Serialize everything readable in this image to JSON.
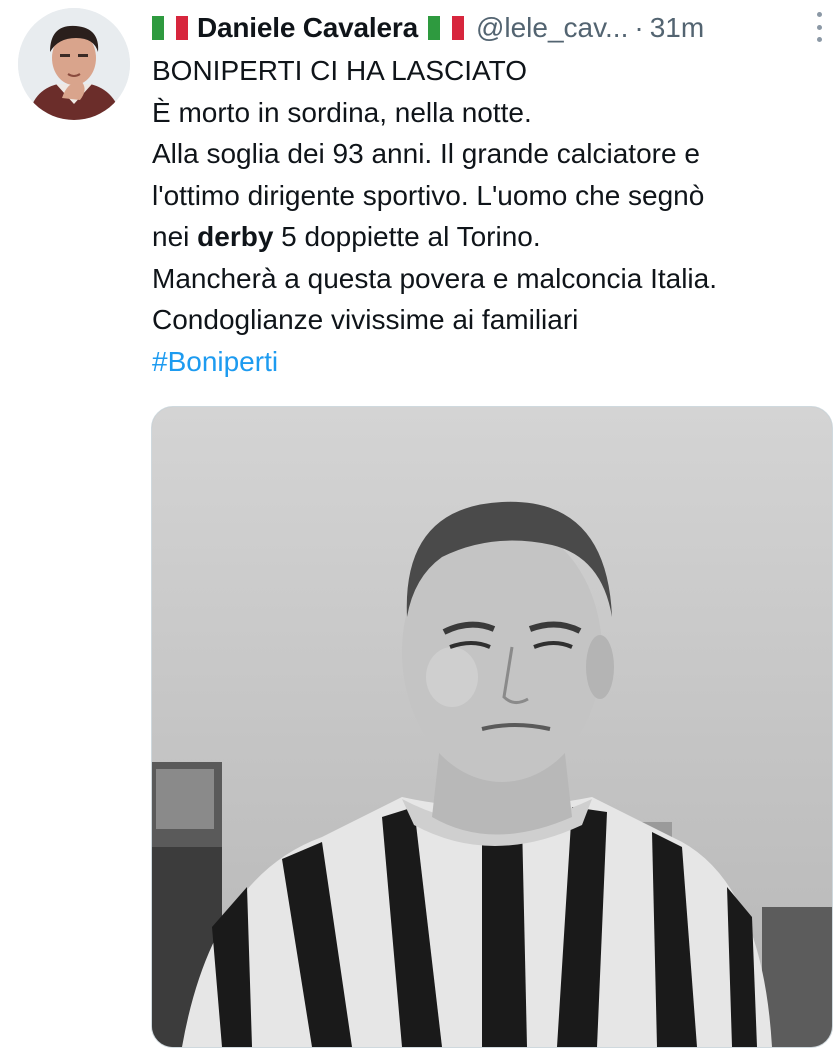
{
  "author": {
    "name": "Daniele Cavalera",
    "handle": "@lele_cav...",
    "separator": "·",
    "time": "31m",
    "flag_emoji": "italian-flag-icon"
  },
  "tweet": {
    "lines": [
      "BONIPERTI CI HA LASCIATO",
      "È morto in sordina, nella notte.",
      "Alla soglia dei 93 anni. Il grande calciatore e",
      "l'ottimo dirigente sportivo. L'uomo che segnò"
    ],
    "line5_prefix": "nei ",
    "line5_bold": "derby",
    "line5_suffix": " 5 doppiette al Torino.",
    "lines_after": [
      "Mancherà a questa povera e malconcia Italia.",
      "Condoglianze vivissime ai familiari"
    ],
    "hashtag": "#Boniperti"
  },
  "colors": {
    "link": "#1d9bf0",
    "secondary_text": "#536471",
    "flag_green": "#2e9a3f",
    "flag_red": "#d7263d"
  }
}
